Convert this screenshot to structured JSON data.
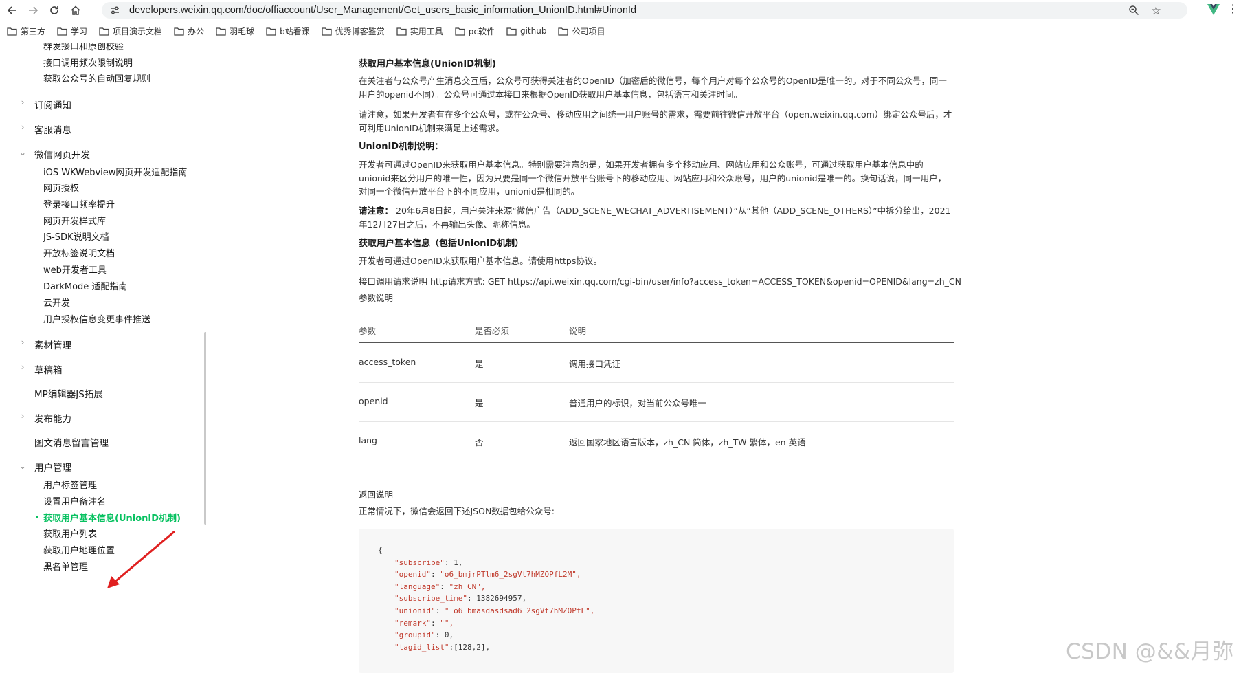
{
  "browser": {
    "url": "developers.weixin.qq.com/doc/offiaccount/User_Management/Get_users_basic_information_UnionID.html#UinonId",
    "bookmarks": [
      "第三方",
      "学习",
      "项目演示文档",
      "办公",
      "羽毛球",
      "b站看课",
      "优秀博客鉴赏",
      "实用工具",
      "pc软件",
      "github",
      "公司项目"
    ]
  },
  "sidebar": {
    "top_items": [
      "群发接口和原创校验",
      "接口调用频次限制说明",
      "获取公众号的自动回复规则"
    ],
    "groups": {
      "subscribe_notice": "订阅通知",
      "customer_message": "客服消息",
      "web_dev": "微信网页开发",
      "material": "素材管理",
      "drafts": "草稿箱",
      "mp_editor": "MP编辑器JS拓展",
      "publish": "发布能力",
      "comments": "图文消息留言管理",
      "user_mgmt": "用户管理"
    },
    "web_dev_items": [
      "iOS WKWebview网页开发适配指南",
      "网页授权",
      "登录接口频率提升",
      "网页开发样式库",
      "JS-SDK说明文档",
      "开放标签说明文档",
      "web开发者工具",
      "DarkMode 适配指南",
      "云开发",
      "用户授权信息变更事件推送"
    ],
    "user_mgmt_items": [
      "用户标签管理",
      "设置用户备注名",
      "获取用户基本信息(UnionID机制)",
      "获取用户列表",
      "获取用户地理位置",
      "黑名单管理"
    ],
    "active_item": "获取用户基本信息(UnionID机制)"
  },
  "content": {
    "title": "获取用户基本信息(UnionID机制)",
    "intro": "在关注者与公众号产生消息交互后，公众号可获得关注者的OpenID（加密后的微信号，每个用户对每个公众号的OpenID是唯一的。对于不同公众号，同一用户的openid不同）。公众号可通过本接口来根据OpenID获取用户基本信息，包括语言和关注时间。",
    "notice": "请注意，如果开发者有在多个公众号，或在公众号、移动应用之间统一用户账号的需求，需要前往微信开放平台（open.weixin.qq.com）绑定公众号后，才可利用UnionID机制来满足上述需求。",
    "unionid_heading": "UnionID机制说明：",
    "unionid_desc": "开发者可通过OpenID来获取用户基本信息。特别需要注意的是，如果开发者拥有多个移动应用、网站应用和公众账号，可通过获取用户基本信息中的unionid来区分用户的唯一性，因为只要是同一个微信开放平台账号下的移动应用、网站应用和公众账号，用户的unionid是唯一的。换句话说，同一用户，对同一个微信开放平台下的不同应用，unionid是相同的。",
    "note_label": "请注意：",
    "note_text": "20年6月8日起，用户关注来源“微信广告（ADD_SCENE_WECHAT_ADVERTISEMENT）”从“其他（ADD_SCENE_OTHERS）”中拆分给出，2021年12月27日之后，不再输出头像、昵称信息。",
    "section_heading": "获取用户基本信息（包括UnionID机制）",
    "section_desc": "开发者可通过OpenID来获取用户基本信息。请使用https协议。",
    "request_desc": "接口调用请求说明 http请求方式: GET https://api.weixin.qq.com/cgi-bin/user/info?access_token=ACCESS_TOKEN&openid=OPENID&lang=zh_CN",
    "params_label": "参数说明",
    "table": {
      "headers": [
        "参数",
        "是否必须",
        "说明"
      ],
      "rows": [
        [
          "access_token",
          "是",
          "调用接口凭证"
        ],
        [
          "openid",
          "是",
          "普通用户的标识，对当前公众号唯一"
        ],
        [
          "lang",
          "否",
          "返回国家地区语言版本，zh_CN 简体，zh_TW 繁体，en 英语"
        ]
      ]
    },
    "return_label": "返回说明",
    "return_desc": "正常情况下，微信会返回下述JSON数据包给公众号:",
    "code_lines": [
      {
        "t": "{"
      },
      {
        "k": "\"subscribe\"",
        "v": " 1,"
      },
      {
        "k": "\"openid\"",
        "v": " \"o6_bmjrPTlm6_2sgVt7hMZOPfL2M\","
      },
      {
        "k": "\"language\"",
        "v": " \"zh_CN\","
      },
      {
        "k": "\"subscribe_time\"",
        "v": " 1382694957,"
      },
      {
        "k": "\"unionid\"",
        "v": " \" o6_bmasdasdsad6_2sgVt7hMZOPfL\","
      },
      {
        "k": "\"remark\"",
        "v": " \"\","
      },
      {
        "k": "\"groupid\"",
        "v": " 0,"
      },
      {
        "k": "\"tagid_list\"",
        "v": "[128,2],"
      }
    ]
  },
  "watermark": "CSDN @&&月弥",
  "colors": {
    "accent": "#07c160",
    "code_key": "#c0392b",
    "annotation": "#e02020"
  }
}
